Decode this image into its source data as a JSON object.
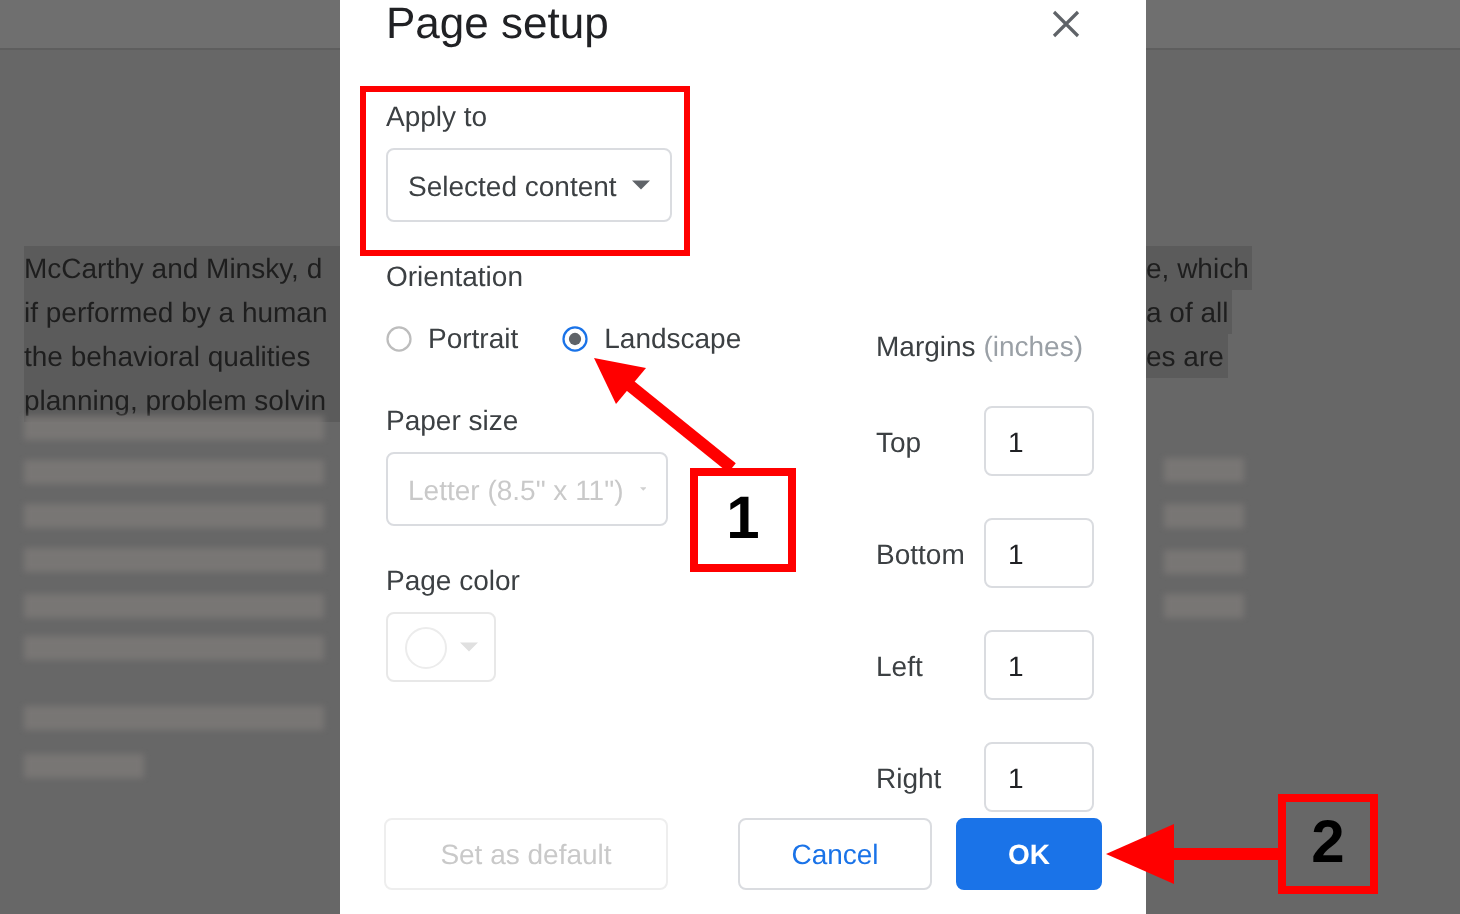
{
  "document": {
    "lines_left": [
      "McCarthy and Minsky, d",
      "if performed by a human",
      "the behavioral qualities",
      "planning, problem solvin"
    ],
    "lines_right": [
      "e, which",
      "a of all",
      "es are"
    ]
  },
  "dialog": {
    "title": "Page setup",
    "apply_to": {
      "label": "Apply to",
      "value": "Selected content"
    },
    "orientation": {
      "label": "Orientation",
      "options": [
        {
          "label": "Portrait",
          "selected": false
        },
        {
          "label": "Landscape",
          "selected": true
        }
      ]
    },
    "paper_size": {
      "label": "Paper size",
      "value": "Letter (8.5\" x 11\")",
      "disabled": true
    },
    "page_color": {
      "label": "Page color",
      "disabled": true
    },
    "margins": {
      "label": "Margins",
      "unit": "(inches)",
      "fields": [
        {
          "label": "Top",
          "value": "1"
        },
        {
          "label": "Bottom",
          "value": "1"
        },
        {
          "label": "Left",
          "value": "1"
        },
        {
          "label": "Right",
          "value": "1"
        }
      ]
    },
    "buttons": [
      {
        "label": "Set as default",
        "kind": "secondary",
        "disabled": true
      },
      {
        "label": "Cancel",
        "kind": "secondary",
        "disabled": false
      },
      {
        "label": "OK",
        "kind": "primary",
        "disabled": false
      }
    ]
  },
  "annotations": [
    {
      "label": "1"
    },
    {
      "label": "2"
    }
  ]
}
